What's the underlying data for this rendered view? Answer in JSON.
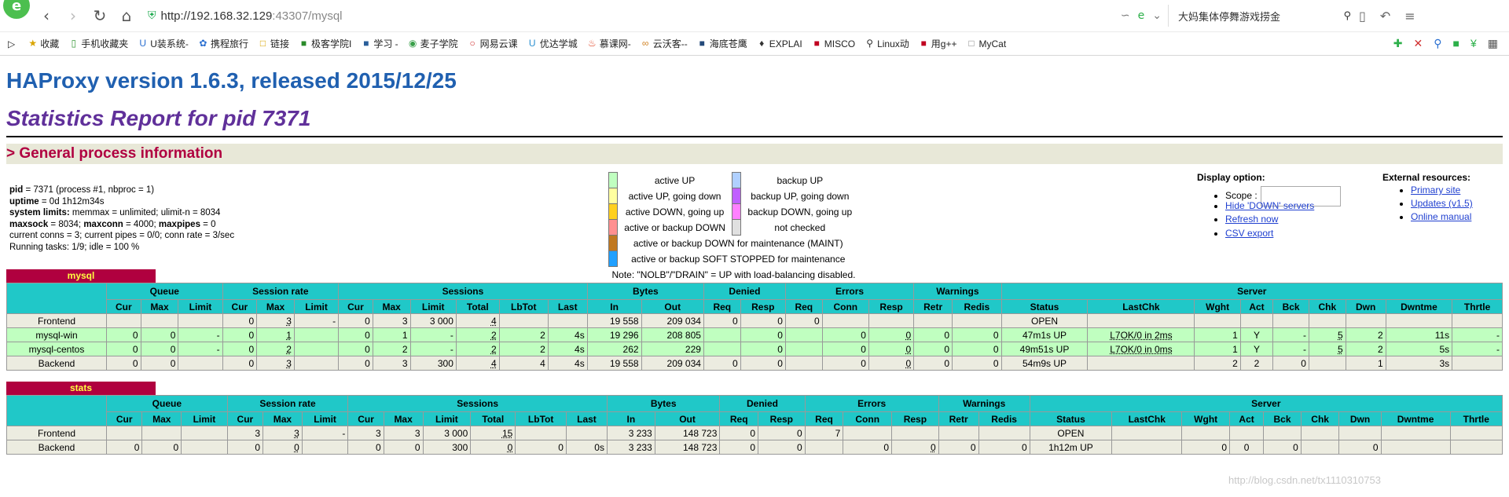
{
  "browser": {
    "url_prefix": "http://192.168.32.129",
    "url_rest": ":43307/mysql",
    "search_text": "大妈集体停舞游戏捞金",
    "bookmarks": [
      "收藏",
      "手机收藏夹",
      "U装系统-",
      "携程旅行",
      "链接",
      "极客学院I",
      "学习 -",
      "麦子学院",
      "网易云课",
      "优达学城",
      "慕课网-",
      "云沃客--",
      "海底苍鹰",
      "EXPLAI",
      "MISCO",
      "Linux动",
      "用g++",
      "MyCat"
    ]
  },
  "page": {
    "title": "HAProxy version 1.6.3, released 2015/12/25",
    "subtitle": "Statistics Report for pid 7371",
    "section": "> General process information",
    "proc_lines": [
      {
        "k": "pid",
        "v": " = 7371 (process #1, nbproc = 1)"
      },
      {
        "k": "uptime",
        "v": " = 0d 1h12m34s"
      },
      {
        "k": "system limits:",
        "v": " memmax = unlimited; ulimit-n = 8034"
      },
      {
        "k": "maxsock",
        "v": " = 8034; "
      }
    ],
    "maxsock_extra": {
      "maxconn": "maxconn",
      "maxconn_v": " = 4000; ",
      "maxpipes": "maxpipes",
      "maxpipes_v": " = 0"
    },
    "conns_line": "current conns = 3; current pipes = 0/0; conn rate = 3/sec",
    "tasks_line": "Running tasks: 1/9; idle = 100 %"
  },
  "legend": {
    "rows": [
      {
        "c1": "#c0ffc0",
        "t1": "active UP",
        "c2": "#b0d0ff",
        "t2": "backup UP"
      },
      {
        "c1": "#ffffa0",
        "t1": "active UP, going down",
        "c2": "#c060ff",
        "t2": "backup UP, going down"
      },
      {
        "c1": "#ffd020",
        "t1": "active DOWN, going up",
        "c2": "#ff80ff",
        "t2": "backup DOWN, going up"
      },
      {
        "c1": "#ff9090",
        "t1": "active or backup DOWN",
        "c2": "#e0e0e0",
        "t2": "not checked"
      }
    ],
    "maint_color": "#c07820",
    "maint": "active or backup DOWN for maintenance (MAINT)",
    "soft_color": "#20a0ff",
    "soft": "active or backup SOFT STOPPED for maintenance",
    "note": "Note: \"NOLB\"/\"DRAIN\" = UP with load-balancing disabled."
  },
  "display": {
    "title": "Display option:",
    "scope": "Scope :",
    "hide": "Hide 'DOWN' servers",
    "refresh": "Refresh now",
    "csv": "CSV export"
  },
  "ext": {
    "title": "External resources:",
    "primary": "Primary site",
    "updates": "Updates (v1.5)",
    "manual": "Online manual"
  },
  "headers": {
    "groups": [
      "Queue",
      "Session rate",
      "Sessions",
      "Bytes",
      "Denied",
      "Errors",
      "Warnings",
      "Server"
    ],
    "cols": [
      "Cur",
      "Max",
      "Limit",
      "Cur",
      "Max",
      "Limit",
      "Cur",
      "Max",
      "Limit",
      "Total",
      "LbTot",
      "Last",
      "In",
      "Out",
      "Req",
      "Resp",
      "Req",
      "Conn",
      "Resp",
      "Retr",
      "Redis",
      "Status",
      "LastChk",
      "Wght",
      "Act",
      "Bck",
      "Chk",
      "Dwn",
      "Dwntme",
      "Thrtle"
    ]
  },
  "proxies": [
    {
      "name": "mysql",
      "rows": [
        {
          "type": "fe",
          "name": "Frontend",
          "cells": [
            "",
            "",
            "",
            "0",
            "3",
            "-",
            "0",
            "3",
            "3 000",
            "4",
            "",
            "",
            "19 558",
            "209 034",
            "0",
            "0",
            "0",
            "",
            "",
            "",
            "",
            "OPEN",
            "",
            "",
            "",
            "",
            "",
            "",
            "",
            ""
          ]
        },
        {
          "type": "up",
          "name": "mysql-win",
          "cells": [
            "0",
            "0",
            "-",
            "0",
            "1",
            "",
            "0",
            "1",
            "-",
            "2",
            "2",
            "4s",
            "19 296",
            "208 805",
            "",
            "0",
            "",
            "0",
            "0",
            "0",
            "0",
            "47m1s UP",
            "L7OK/0 in 2ms",
            "1",
            "Y",
            "-",
            "5",
            "2",
            "11s",
            "-"
          ]
        },
        {
          "type": "up",
          "name": "mysql-centos",
          "cells": [
            "0",
            "0",
            "-",
            "0",
            "2",
            "",
            "0",
            "2",
            "-",
            "2",
            "2",
            "4s",
            "262",
            "229",
            "",
            "0",
            "",
            "0",
            "0",
            "0",
            "0",
            "49m51s UP",
            "L7OK/0 in 0ms",
            "1",
            "Y",
            "-",
            "5",
            "2",
            "5s",
            "-"
          ]
        },
        {
          "type": "be",
          "name": "Backend",
          "cells": [
            "0",
            "0",
            "",
            "0",
            "3",
            "",
            "0",
            "3",
            "300",
            "4",
            "4",
            "4s",
            "19 558",
            "209 034",
            "0",
            "0",
            "",
            "0",
            "0",
            "0",
            "0",
            "54m9s UP",
            "",
            "2",
            "2",
            "0",
            "",
            "1",
            "3s",
            ""
          ]
        }
      ]
    },
    {
      "name": "stats",
      "rows": [
        {
          "type": "fe",
          "name": "Frontend",
          "cells": [
            "",
            "",
            "",
            "3",
            "3",
            "-",
            "3",
            "3",
            "3 000",
            "15",
            "",
            "",
            "3 233",
            "148 723",
            "0",
            "0",
            "7",
            "",
            "",
            "",
            "",
            "OPEN",
            "",
            "",
            "",
            "",
            "",
            "",
            "",
            ""
          ]
        },
        {
          "type": "be",
          "name": "Backend",
          "cells": [
            "0",
            "0",
            "",
            "0",
            "0",
            "",
            "0",
            "0",
            "300",
            "0",
            "0",
            "0s",
            "3 233",
            "148 723",
            "0",
            "0",
            "",
            "0",
            "0",
            "0",
            "0",
            "1h12m UP",
            "",
            "0",
            "0",
            "0",
            "",
            "0",
            "",
            ""
          ]
        }
      ]
    }
  ],
  "watermark": "http://blog.csdn.net/tx1110310753"
}
